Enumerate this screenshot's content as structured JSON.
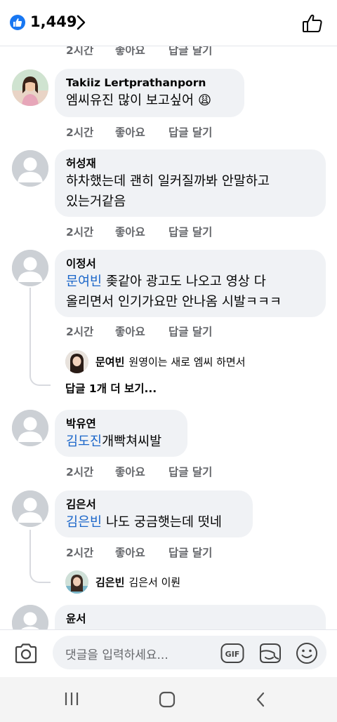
{
  "header": {
    "like_count": "1,449"
  },
  "actions": {
    "time": "2시간",
    "like": "좋아요",
    "reply": "답글 달기"
  },
  "comments": [
    {
      "author": "Takiiz Lertprathanporn",
      "text": "엠씨유진 많이 보고싶어",
      "emoji": "😩"
    },
    {
      "author": "허성재",
      "text_line1": "하차했는데 괜히 일커질까봐 안말하고",
      "text_line2": "있는거같음"
    },
    {
      "author": "이정서",
      "mention": "문여빈",
      "text_line1": "좆같아 광고도 나오고 영상 다",
      "text_line2": "올리면서 인기가요만 안나옴 시발ㅋㅋㅋ",
      "reply_preview": {
        "author": "문여빈",
        "text": "원영이는 새로 엠씨 하면서"
      },
      "more_replies": "답글 1개 더 보기..."
    },
    {
      "author": "박유연",
      "mention": "김도진",
      "text": "개빡쳐씨발"
    },
    {
      "author": "김은서",
      "mention": "김은빈",
      "text": "나도 궁금햇는데 떳네",
      "reply_preview": {
        "author": "김은빈",
        "text": "김은서 이뤈"
      }
    },
    {
      "author": "윤서"
    }
  ],
  "composer": {
    "placeholder": "댓글을 입력하세요...",
    "gif_label": "GIF"
  },
  "colors": {
    "accent": "#1877f2",
    "mention": "#1b66c9",
    "bubble": "#f0f2f5",
    "meta": "#65676b"
  }
}
